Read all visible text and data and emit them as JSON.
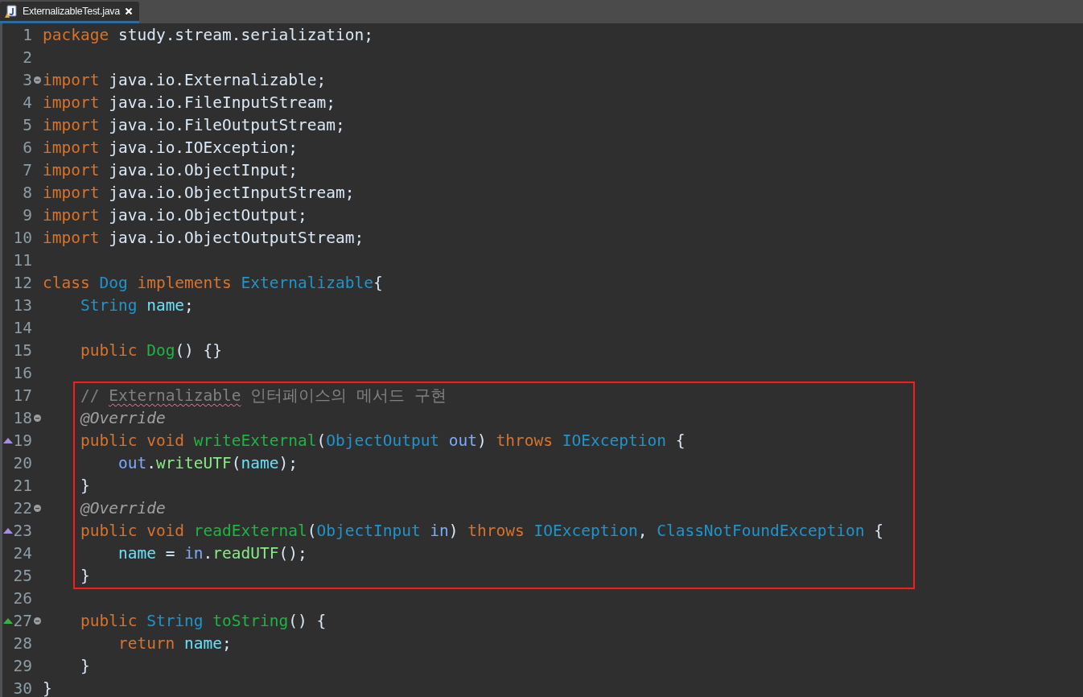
{
  "tabs": [
    {
      "title": "ExternalizableTest.java",
      "selected": true
    }
  ],
  "blocks": [
    {
      "highlighted": false,
      "lines": [
        {
          "number": "1",
          "kind": "plain",
          "foldable": false,
          "tokens": [
            {
              "kind": "keyword",
              "text": "package"
            },
            {
              "kind": "plain",
              "text": " study.stream.serialization;"
            }
          ]
        },
        {
          "number": "2",
          "kind": "plain",
          "foldable": false
        },
        {
          "number": "3",
          "kind": "plain",
          "foldable": true,
          "tokens": [
            {
              "kind": "keyword",
              "text": "import"
            },
            {
              "kind": "plain",
              "text": " java.io.Externalizable;"
            }
          ]
        },
        {
          "number": "4",
          "kind": "plain",
          "foldable": false,
          "tokens": [
            {
              "kind": "keyword",
              "text": "import"
            },
            {
              "kind": "plain",
              "text": " java.io.FileInputStream;"
            }
          ]
        },
        {
          "number": "5",
          "kind": "plain",
          "foldable": false,
          "tokens": [
            {
              "kind": "keyword",
              "text": "import"
            },
            {
              "kind": "plain",
              "text": " java.io.FileOutputStream;"
            }
          ]
        },
        {
          "number": "6",
          "kind": "plain",
          "foldable": false,
          "tokens": [
            {
              "kind": "keyword",
              "text": "import"
            },
            {
              "kind": "plain",
              "text": " java.io.IOException;"
            }
          ]
        },
        {
          "number": "7",
          "kind": "plain",
          "foldable": false,
          "tokens": [
            {
              "kind": "keyword",
              "text": "import"
            },
            {
              "kind": "plain",
              "text": " java.io.ObjectInput;"
            }
          ]
        },
        {
          "number": "8",
          "kind": "plain",
          "foldable": false,
          "tokens": [
            {
              "kind": "keyword",
              "text": "import"
            },
            {
              "kind": "plain",
              "text": " java.io.ObjectInputStream;"
            }
          ]
        },
        {
          "number": "9",
          "kind": "plain",
          "foldable": false,
          "tokens": [
            {
              "kind": "keyword",
              "text": "import"
            },
            {
              "kind": "plain",
              "text": " java.io.ObjectOutput;"
            }
          ]
        },
        {
          "number": "10",
          "kind": "plain",
          "foldable": false,
          "tokens": [
            {
              "kind": "keyword",
              "text": "import"
            },
            {
              "kind": "plain",
              "text": " java.io.ObjectOutputStream;"
            }
          ]
        },
        {
          "number": "11",
          "kind": "plain",
          "foldable": false
        },
        {
          "number": "12",
          "kind": "plain",
          "foldable": false,
          "tokens": [
            {
              "kind": "keyword",
              "text": "class"
            },
            {
              "kind": "type",
              "text": " Dog"
            },
            {
              "kind": "keyword",
              "text": " implements"
            },
            {
              "kind": "type",
              "text": " Externalizable"
            },
            {
              "kind": "plain",
              "text": "{"
            }
          ]
        },
        {
          "number": "13",
          "kind": "plain",
          "foldable": false,
          "tokens": [
            {
              "kind": "type",
              "text": "    String"
            },
            {
              "kind": "field",
              "text": " name"
            },
            {
              "kind": "plain",
              "text": ";"
            }
          ]
        },
        {
          "number": "14",
          "kind": "plain",
          "foldable": false
        },
        {
          "number": "15",
          "kind": "plain",
          "foldable": false,
          "tokens": [
            {
              "kind": "keyword",
              "text": "    public"
            },
            {
              "kind": "method_decl",
              "text": " Dog"
            },
            {
              "kind": "plain",
              "text": "() {}"
            }
          ]
        },
        {
          "number": "16",
          "kind": "plain",
          "foldable": false
        }
      ]
    },
    {
      "highlighted": true,
      "lines": [
        {
          "number": "17",
          "kind": "plain",
          "foldable": false,
          "tokens": [
            {
              "kind": "comment",
              "text": "    // "
            },
            {
              "kind": "spelling_error",
              "text": "Externalizable"
            },
            {
              "kind": "comment",
              "text": " 인터페이스의 메서드 구현"
            }
          ]
        },
        {
          "number": "18",
          "kind": "plain",
          "foldable": true,
          "tokens": [
            {
              "kind": "annotation",
              "text": "    @Override"
            }
          ]
        },
        {
          "number": "19",
          "kind": "override",
          "foldable": false,
          "tokens": [
            {
              "kind": "keyword",
              "text": "    public void"
            },
            {
              "kind": "method_decl",
              "text": " writeExternal"
            },
            {
              "kind": "plain",
              "text": "("
            },
            {
              "kind": "type",
              "text": "ObjectOutput"
            },
            {
              "kind": "param",
              "text": " out"
            },
            {
              "kind": "plain",
              "text": ") "
            },
            {
              "kind": "keyword",
              "text": "throws"
            },
            {
              "kind": "type",
              "text": " IOException"
            },
            {
              "kind": "plain",
              "text": " {"
            }
          ]
        },
        {
          "number": "20",
          "kind": "plain",
          "foldable": false,
          "tokens": [
            {
              "kind": "param",
              "text": "        out"
            },
            {
              "kind": "plain",
              "text": "."
            },
            {
              "kind": "method_call",
              "text": "writeUTF"
            },
            {
              "kind": "plain",
              "text": "("
            },
            {
              "kind": "field",
              "text": "name"
            },
            {
              "kind": "plain",
              "text": ");"
            }
          ]
        },
        {
          "number": "21",
          "kind": "plain",
          "foldable": false,
          "tokens": [
            {
              "kind": "plain",
              "text": "    }"
            }
          ]
        },
        {
          "number": "22",
          "kind": "plain",
          "foldable": true,
          "tokens": [
            {
              "kind": "annotation",
              "text": "    @Override"
            }
          ]
        },
        {
          "number": "23",
          "kind": "override",
          "foldable": false,
          "tokens": [
            {
              "kind": "keyword",
              "text": "    public void"
            },
            {
              "kind": "method_decl",
              "text": " readExternal"
            },
            {
              "kind": "plain",
              "text": "("
            },
            {
              "kind": "type",
              "text": "ObjectInput"
            },
            {
              "kind": "param",
              "text": " in"
            },
            {
              "kind": "plain",
              "text": ") "
            },
            {
              "kind": "keyword",
              "text": "throws"
            },
            {
              "kind": "type",
              "text": " IOException"
            },
            {
              "kind": "plain",
              "text": ", "
            },
            {
              "kind": "type",
              "text": "ClassNotFoundException"
            },
            {
              "kind": "plain",
              "text": " {"
            }
          ]
        },
        {
          "number": "24",
          "kind": "plain",
          "foldable": false,
          "tokens": [
            {
              "kind": "field",
              "text": "        name"
            },
            {
              "kind": "plain",
              "text": " = "
            },
            {
              "kind": "param",
              "text": "in"
            },
            {
              "kind": "plain",
              "text": "."
            },
            {
              "kind": "method_call",
              "text": "readUTF"
            },
            {
              "kind": "plain",
              "text": "();"
            }
          ]
        },
        {
          "number": "25",
          "kind": "plain",
          "foldable": false,
          "tokens": [
            {
              "kind": "plain",
              "text": "    }"
            }
          ]
        }
      ]
    },
    {
      "highlighted": false,
      "lines": [
        {
          "number": "26",
          "kind": "plain",
          "foldable": false
        },
        {
          "number": "27",
          "kind": "implements",
          "foldable": true,
          "tokens": [
            {
              "kind": "keyword",
              "text": "    public"
            },
            {
              "kind": "type",
              "text": " String"
            },
            {
              "kind": "method_decl",
              "text": " toString"
            },
            {
              "kind": "plain",
              "text": "() {"
            }
          ]
        },
        {
          "number": "28",
          "kind": "plain",
          "foldable": false,
          "tokens": [
            {
              "kind": "keyword",
              "text": "        return"
            },
            {
              "kind": "field",
              "text": " name"
            },
            {
              "kind": "plain",
              "text": ";"
            }
          ]
        },
        {
          "number": "29",
          "kind": "plain",
          "foldable": false,
          "tokens": [
            {
              "kind": "plain",
              "text": "    }"
            }
          ]
        },
        {
          "number": "30",
          "kind": "plain",
          "foldable": false,
          "tokens": [
            {
              "kind": "plain",
              "text": "}"
            }
          ]
        }
      ]
    }
  ]
}
